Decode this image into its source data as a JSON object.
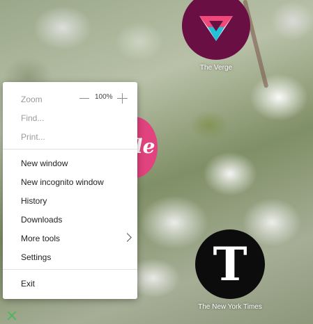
{
  "background": {
    "style": "blurred-white-blossoms-photo"
  },
  "tiles": {
    "verge": {
      "label": "The Verge",
      "color": "#6a0f43",
      "icon": "verge-logo-icon"
    },
    "nyt": {
      "label": "The New York Times",
      "color": "#0c0c0c",
      "glyph": "T",
      "icon": "nyt-logo-icon"
    },
    "partial": {
      "color": "#e0437d",
      "glyph": "le"
    }
  },
  "menu": {
    "zoom_label": "Zoom",
    "zoom_value": "100%",
    "find_label": "Find...",
    "print_label": "Print...",
    "new_window_label": "New window",
    "new_incognito_label": "New incognito window",
    "history_label": "History",
    "downloads_label": "Downloads",
    "more_tools_label": "More tools",
    "settings_label": "Settings",
    "exit_label": "Exit"
  },
  "close": {
    "icon": "close-icon",
    "color": "#4fb560"
  }
}
